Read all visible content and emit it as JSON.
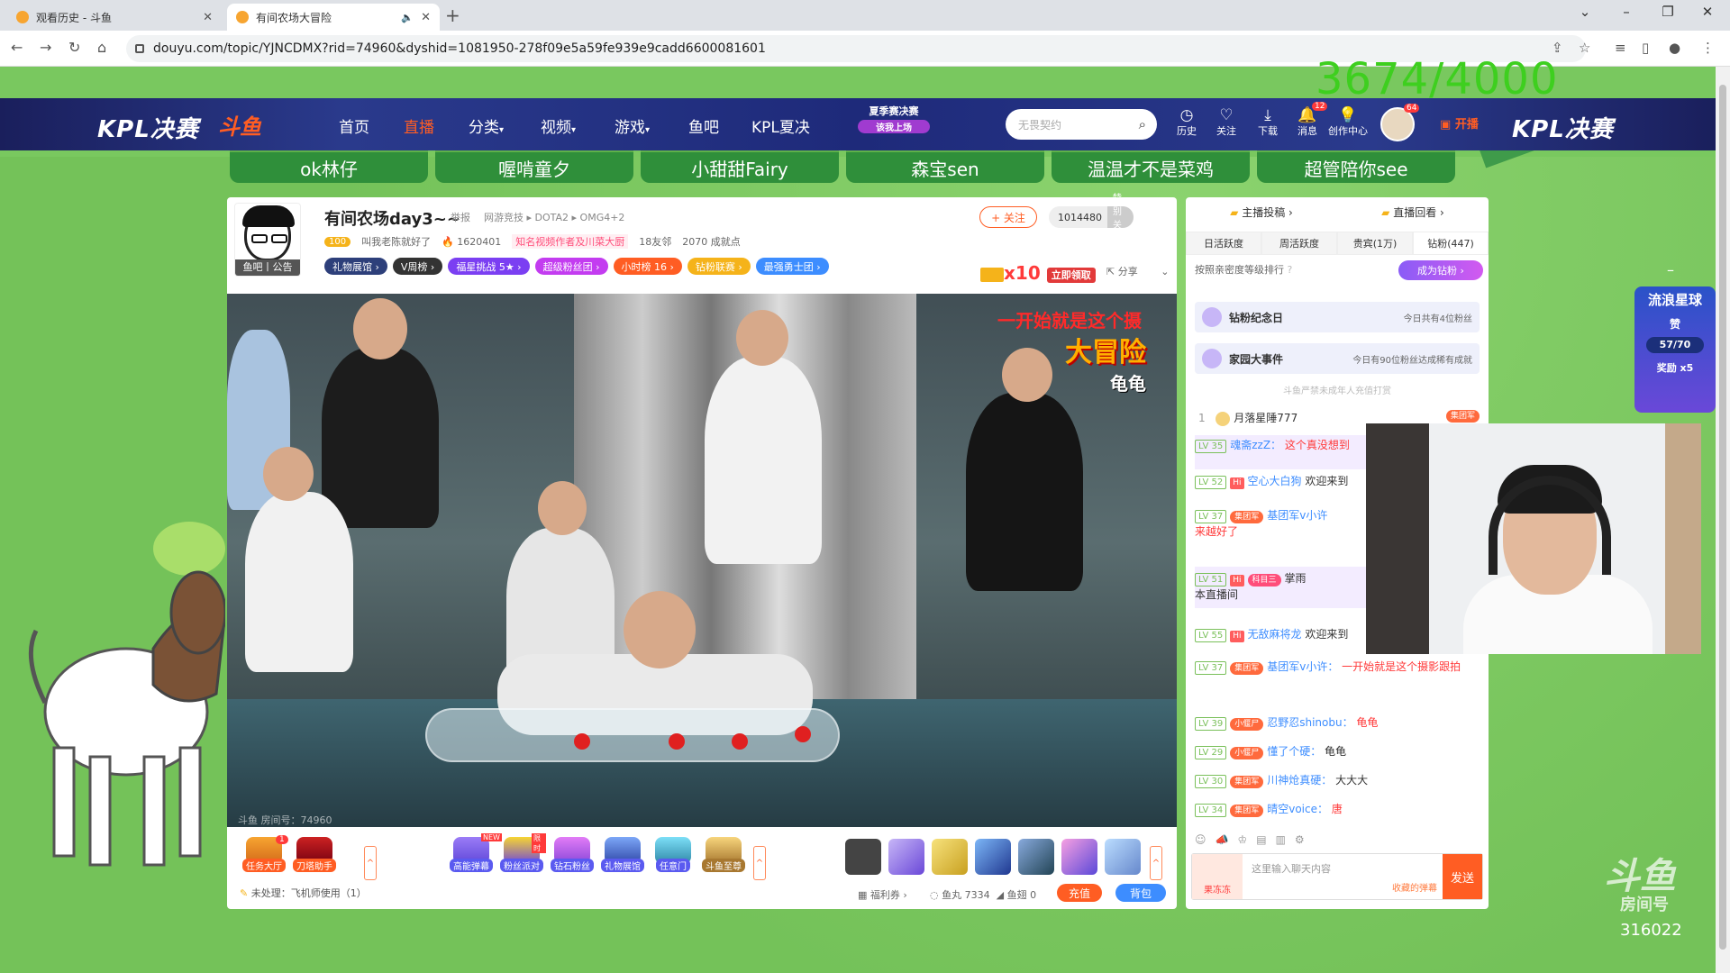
{
  "browser": {
    "tabs": [
      {
        "title": "观看历史 - 斗鱼",
        "active": false
      },
      {
        "title": "有间农场大冒险",
        "active": true
      }
    ],
    "url": "douyu.com/topic/YJNCDMX?rid=74960&dyshid=1081950-278f09e5a59fe939e9cadd6600081601"
  },
  "overlay_counter": "3674/4000",
  "topnav": {
    "kpl_left": "KPL决赛",
    "logo": "斗鱼",
    "items": [
      "首页",
      "直播",
      "分类",
      "视频",
      "游戏",
      "鱼吧",
      "KPL夏决"
    ],
    "active_item": "直播",
    "promo_top": "夏季赛决赛",
    "promo_bottom": "该我上场",
    "search_placeholder": "无畏契约",
    "icons": [
      {
        "label": "历史",
        "icon": "clock-icon"
      },
      {
        "label": "关注",
        "icon": "heart-icon"
      },
      {
        "label": "下载",
        "icon": "download-icon"
      },
      {
        "label": "消息",
        "icon": "bell-icon",
        "badge": "12"
      },
      {
        "label": "创作中心",
        "icon": "bulb-icon"
      }
    ],
    "avatar_badge": "64",
    "kaibo": "开播",
    "kpl_right": "KPL决赛"
  },
  "strip": [
    "ok林仔",
    "喔啃童夕",
    "小甜甜Fairy",
    "森宝sen",
    "温温才不是菜鸡",
    "超管陪你see"
  ],
  "room": {
    "title": "有间农场day3~~",
    "report": "举报",
    "breadcrumb": "网游竞技 ▸ DOTA2 ▸ OMG4+2",
    "level": "100",
    "anchor_name": "叫我老陈就好了",
    "hot": "1620401",
    "tag": "知名视频作者及川菜大厨",
    "friends": "18友邻",
    "achievements": "2070 成就点",
    "anchor_pic_label": "鱼吧丨公告",
    "badges": [
      {
        "label": "礼物展馆 ›",
        "color": "#2d3f7a"
      },
      {
        "label": "V周榜 ›",
        "color": "#333333"
      },
      {
        "label": "福星挑战 5★ ›",
        "color": "#7b3ff2"
      },
      {
        "label": "超级粉丝团 ›",
        "color": "#c33cf0"
      },
      {
        "label": "小时榜 16 ›",
        "color": "#ff5d23"
      },
      {
        "label": "钻粉联赛 ›",
        "color": "#f5b31a"
      },
      {
        "label": "最强勇士团 ›",
        "color": "#3d8dff"
      }
    ],
    "follow": "+ 关注",
    "fans": "1014480",
    "fans_btn": "特别关注",
    "gift_banner": "x10",
    "gift_claim": "立即领取",
    "share": "分享",
    "video_caption1": "一开始就是这个摄",
    "video_caption2": "大冒险",
    "video_caption3": "龟龟",
    "room_id": "斗鱼 房间号：74960"
  },
  "toolbar": {
    "tools": [
      {
        "label": "任务大厅",
        "badge": "1"
      },
      {
        "label": "刀塔助手"
      }
    ],
    "features": [
      {
        "label": "高能弹幕",
        "tag": "NEW"
      },
      {
        "label": "粉丝派对",
        "tag": "限时"
      },
      {
        "label": "钻石粉丝"
      },
      {
        "label": "礼物展馆"
      },
      {
        "label": "任意门"
      },
      {
        "label": "斗鱼至尊"
      }
    ],
    "unprocessed": "未处理：飞机师使用（1）",
    "fuli": "福利券 ›",
    "yuwan": "鱼丸 7334",
    "yuchi": "鱼翅 0",
    "recharge": "充值",
    "bag": "背包"
  },
  "chat": {
    "top_tabs": [
      "主播投稿 ›",
      "直播回看 ›"
    ],
    "rank_tabs": [
      "日活跃度",
      "周活跃度",
      "贵宾(1万)",
      "钻粉(447)"
    ],
    "rank_hint": "按照亲密度等级排行",
    "become_fan": "成为钻粉 ›",
    "promos": [
      {
        "title": "钻粉纪念日",
        "right": "今日共有4位粉丝"
      },
      {
        "title": "家园大事件",
        "right": "今日有90位粉丝达成稀有成就"
      }
    ],
    "minor_notice": "斗鱼严禁未成年人充值打赏",
    "rank1": {
      "rank": "1",
      "name": "月落星陲777",
      "tag": "集团军"
    },
    "messages": [
      {
        "lv": "LV 35",
        "name": "魂斋zzZ：",
        "text": "这个真没想到"
      },
      {
        "lv": "LV 52",
        "hi": "Hi",
        "name": "空心大白狗",
        "text": "欢迎来到"
      },
      {
        "lv": "LV 37",
        "tag": "集团军",
        "name": "基团军v小许",
        "text": "来越好了"
      },
      {
        "lv": "LV 51",
        "hi": "Hi",
        "tag": "科目三",
        "name": "掌雨",
        "text": "本直播间"
      },
      {
        "lv": "LV 55",
        "hi": "Hi",
        "name": "无敌麻将龙",
        "text": "欢迎来到"
      },
      {
        "lv": "LV 37",
        "tag": "集团军",
        "name": "基团军v小许：",
        "text": "一开始就是这个摄影跟拍"
      },
      {
        "lv": "LV 39",
        "tag": "小偃尸",
        "name": "忍野忍shinobu：",
        "text": "龟龟"
      },
      {
        "lv": "LV 29",
        "tag": "小偃尸",
        "name": "懂了个硬：",
        "text": "龟龟"
      },
      {
        "lv": "LV 30",
        "tag": "集团军",
        "name": "川神炝真硬：",
        "text": "大大大"
      },
      {
        "lv": "LV 34",
        "tag": "集团军",
        "name": "晴空voice：",
        "text": "唐"
      }
    ],
    "input_placeholder": "这里输入聊天内容",
    "collect": "收藏的弹幕",
    "send": "发送",
    "fan_label": "果冻冻"
  },
  "side_promo": {
    "title": "流浪星球",
    "sub": "赞",
    "count": "57/70",
    "reward": "奖励 x5"
  },
  "watermark": {
    "logo": "斗鱼",
    "room_label": "房间号",
    "room_number": "316022"
  }
}
